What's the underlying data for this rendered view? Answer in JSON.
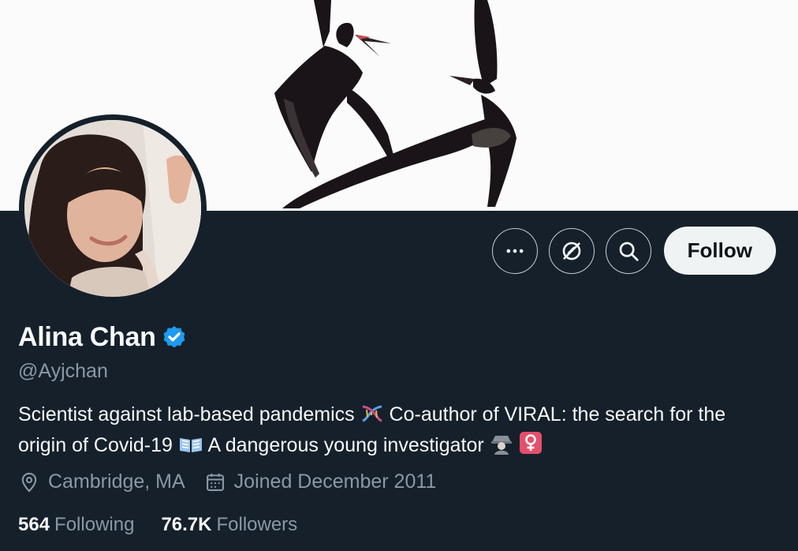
{
  "profile": {
    "name": "Alina Chan",
    "handle": "@Ayjchan",
    "bio_line1": "Scientist against lab-based pandemics",
    "bio_line1b": "Co-author of VIRAL: the search for the",
    "bio_line2": "origin of Covid-19",
    "bio_line2b": "A dangerous young investigator",
    "location": "Cambridge, MA",
    "joined": "Joined December 2011",
    "following_count": "564",
    "following_label": "Following",
    "followers_count": "76.7K",
    "followers_label": "Followers"
  },
  "actions": {
    "more_icon": "more-icon",
    "subscribe_icon": "subscribe-icon",
    "search_icon": "search-icon",
    "follow_label": "Follow"
  },
  "icons": {
    "verified": "verified-badge-icon",
    "bio_emojis": [
      "dna-emoji",
      "open-book-emoji",
      "detective-emoji",
      "female-sign-emoji"
    ],
    "location": "location-pin-icon",
    "calendar": "calendar-icon"
  },
  "colors": {
    "background": "#15202b",
    "verified_blue": "#1d9bf0",
    "muted_text": "#8b98a5",
    "follow_button": "#eff3f4"
  }
}
